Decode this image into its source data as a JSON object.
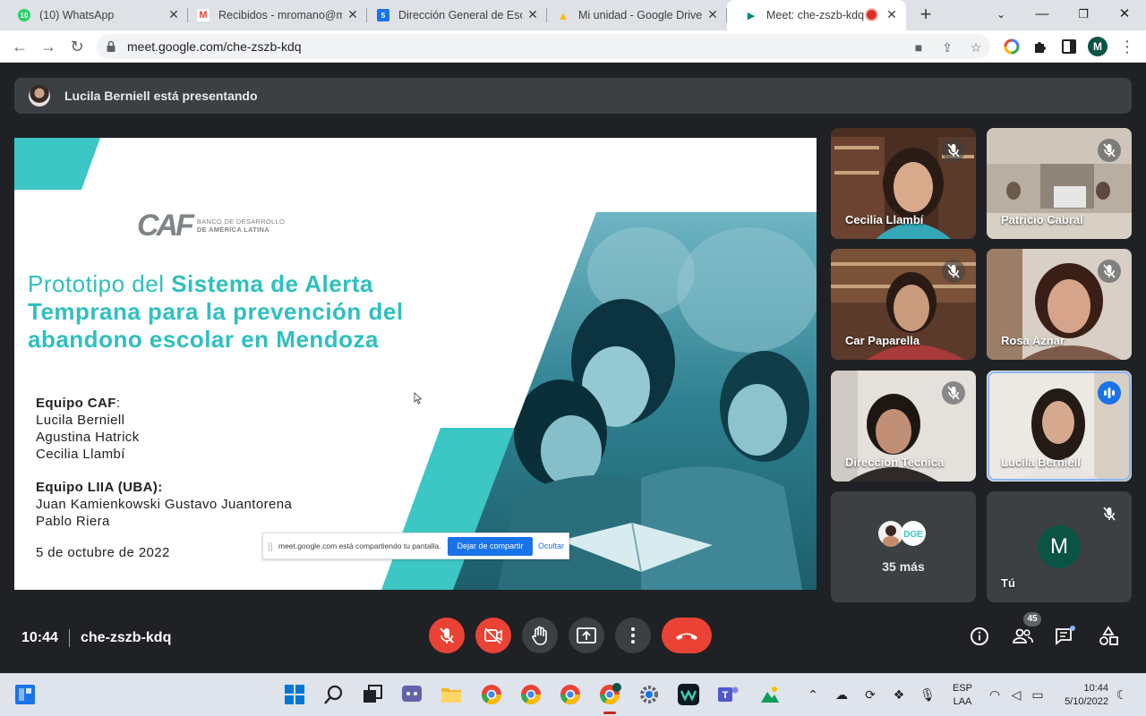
{
  "browser": {
    "tabs": [
      {
        "title": "(10) WhatsApp",
        "favicon_badge": "10",
        "favicon_color": "#25d366"
      },
      {
        "title": "Recibidos - mromano@m",
        "favicon_badge": "M",
        "favicon_color": "#ea4335"
      },
      {
        "title": "Dirección General de Escu",
        "favicon_badge": "5",
        "favicon_color": "#1a73e8"
      },
      {
        "title": "Mi unidad - Google Drive",
        "favicon_badge": "▲",
        "favicon_color": "#fbbc04"
      },
      {
        "title": "Meet: che-zszb-kdq",
        "favicon_badge": "▶",
        "favicon_color": "#00897b"
      }
    ],
    "active_tab_index": 4,
    "url": "meet.google.com/che-zszb-kdq",
    "profile_initial": "M"
  },
  "meet": {
    "presenting_banner": "Lucila Berniell está presentando",
    "slide": {
      "logo_text": "CAF",
      "logo_subtitle_line1": "BANCO DE DESARROLLO",
      "logo_subtitle_line2": "DE AMÉRICA LATINA",
      "title_regular": "Prototipo del ",
      "title_bold": "Sistema de Alerta Temprana para la prevención del abandono escolar en Mendoza",
      "team_caf_heading": "Equipo CAF",
      "team_caf_heading_suffix": ":",
      "team_caf_members": [
        "Lucila Berniell",
        "Agustina Hatrick",
        "Cecilia Llambí"
      ],
      "team_liia_heading": "Equipo LIIA (UBA):",
      "team_liia_members": [
        "Juan Kamienkowski Gustavo Juantorena",
        "Pablo Riera"
      ],
      "date": "5 de octubre de 2022"
    },
    "share_notice": {
      "message": "meet.google.com está compartiendo tu pantalla.",
      "stop_button": "Dejar de compartir",
      "hide_link": "Ocultar"
    },
    "participants": [
      {
        "name": "Cecilia Llambí",
        "muted": true
      },
      {
        "name": "Patricio Cabral",
        "muted": true
      },
      {
        "name": "Car Paparella",
        "muted": true
      },
      {
        "name": "Rosa Aznar",
        "muted": true
      },
      {
        "name": "Direccion Tecnica",
        "muted": true
      },
      {
        "name": "Lucila Berniell",
        "muted": false,
        "speaking": true
      }
    ],
    "more_participants": "35 más",
    "more_badge_text": "DGE",
    "self": {
      "name": "Tú",
      "initial": "M",
      "muted": true
    },
    "clock": "10:44",
    "meeting_code": "che-zszb-kdq",
    "participant_count": "45"
  },
  "taskbar": {
    "language_line1": "ESP",
    "language_line2": "LAA",
    "time": "10:44",
    "date": "5/10/2022"
  },
  "colors": {
    "accent_teal": "#2fbfbf",
    "meet_dark": "#202124",
    "danger_red": "#ea4335",
    "meet_blue": "#1a73e8"
  }
}
